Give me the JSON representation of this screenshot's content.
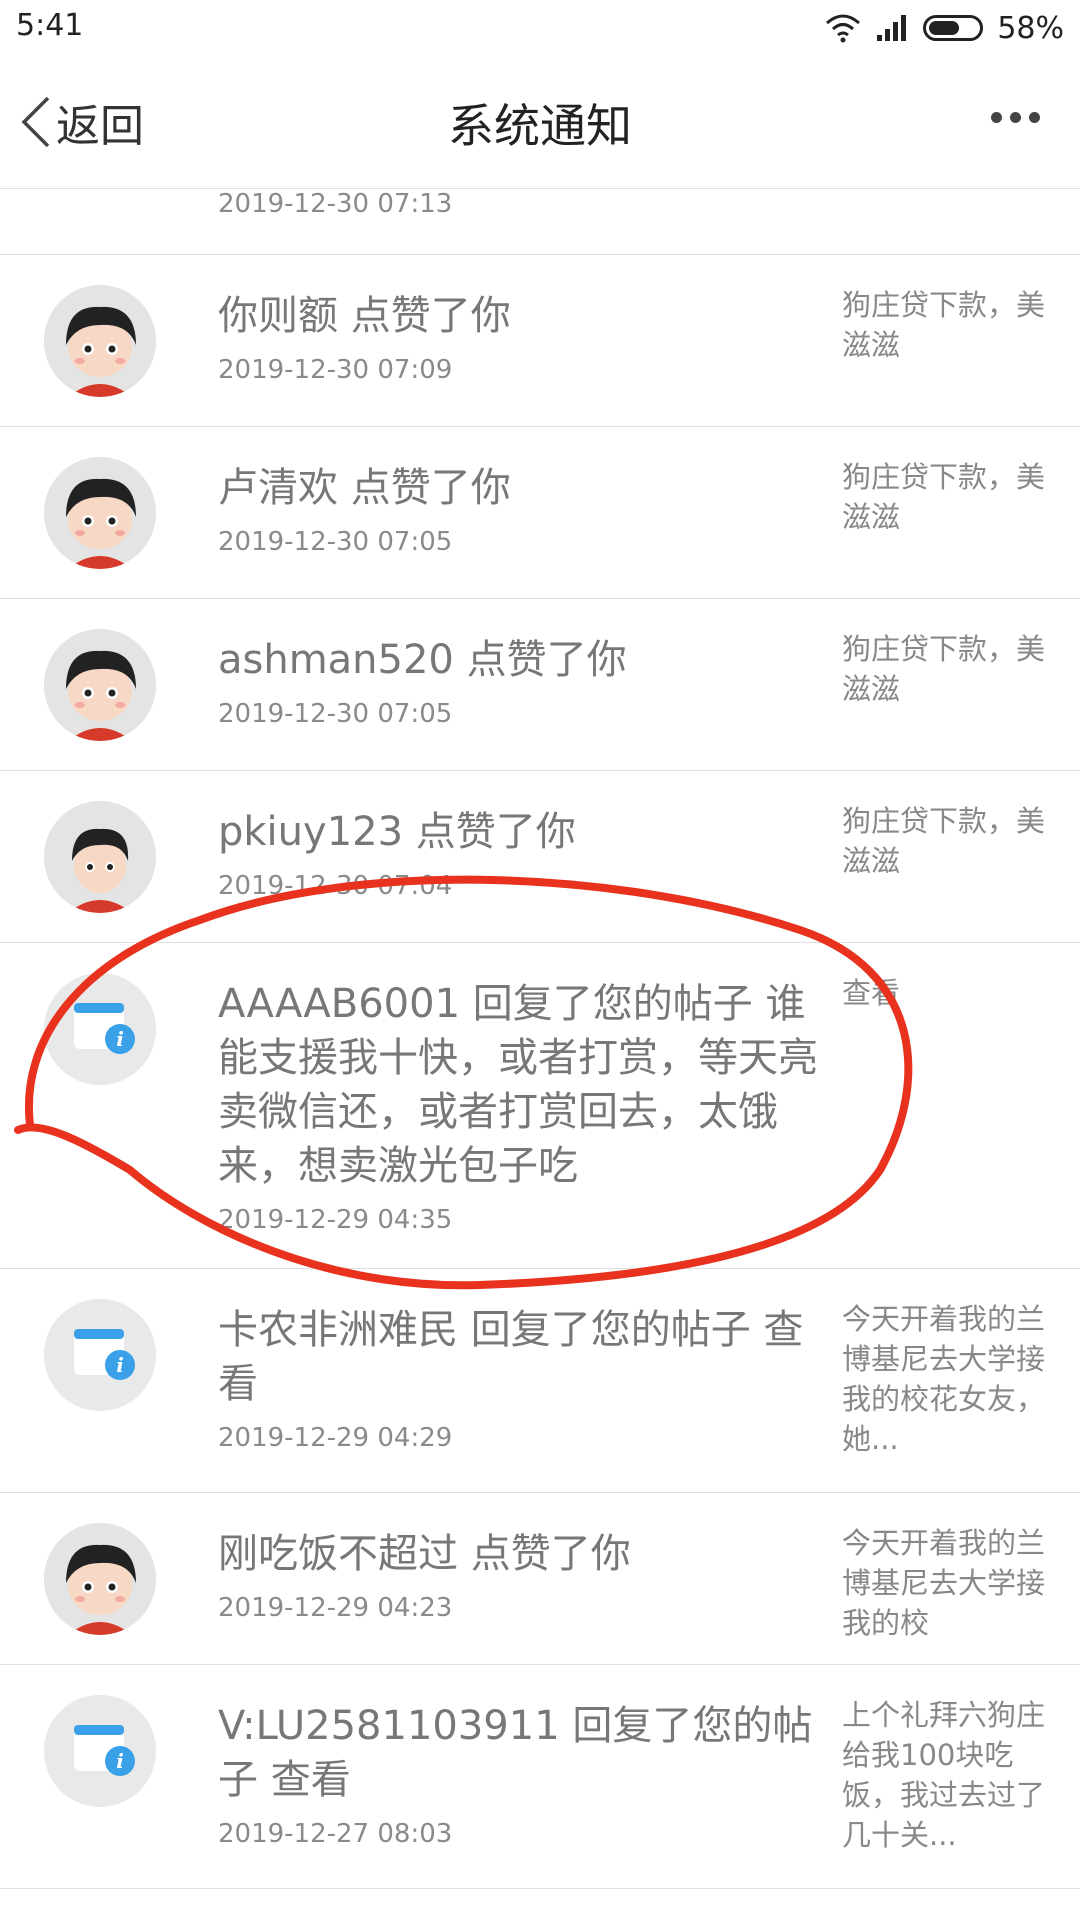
{
  "status": {
    "time": "5:41",
    "battery": "58%"
  },
  "header": {
    "back": "返回",
    "title": "系统通知"
  },
  "notifications": [
    {
      "main": "",
      "time": "2019-12-30 07:13",
      "side": ""
    },
    {
      "main": "你则额 点赞了你",
      "time": "2019-12-30 07:09",
      "side": "狗庄贷下款，美滋滋"
    },
    {
      "main": "卢清欢 点赞了你",
      "time": "2019-12-30 07:05",
      "side": "狗庄贷下款，美滋滋"
    },
    {
      "main": "ashman520 点赞了你",
      "time": "2019-12-30 07:05",
      "side": "狗庄贷下款，美滋滋"
    },
    {
      "main": "pkiuy123 点赞了你",
      "time": "2019-12-30 07:04",
      "side": "狗庄贷下款，美滋滋"
    },
    {
      "main": "AAAAB6001 回复了您的帖子 谁能支援我十快，或者打赏，等天亮卖微信还，或者打赏回去，太饿来，想卖激光包子吃",
      "time": "2019-12-29 04:35",
      "side": "查看"
    },
    {
      "main": "卡农非洲难民 回复了您的帖子 查看",
      "time": "2019-12-29 04:29",
      "side": "今天开着我的兰博基尼去大学接我的校花女友，她..."
    },
    {
      "main": "刚吃饭不超过 点赞了你",
      "time": "2019-12-29 04:23",
      "side": "今天开着我的兰博基尼去大学接我的校"
    },
    {
      "main": "V:LU2581103911 回复了您的帖子 查看",
      "time": "2019-12-27 08:03",
      "side": "上个礼拜六狗庄给我100块吃饭，我过去过了几十关..."
    }
  ]
}
